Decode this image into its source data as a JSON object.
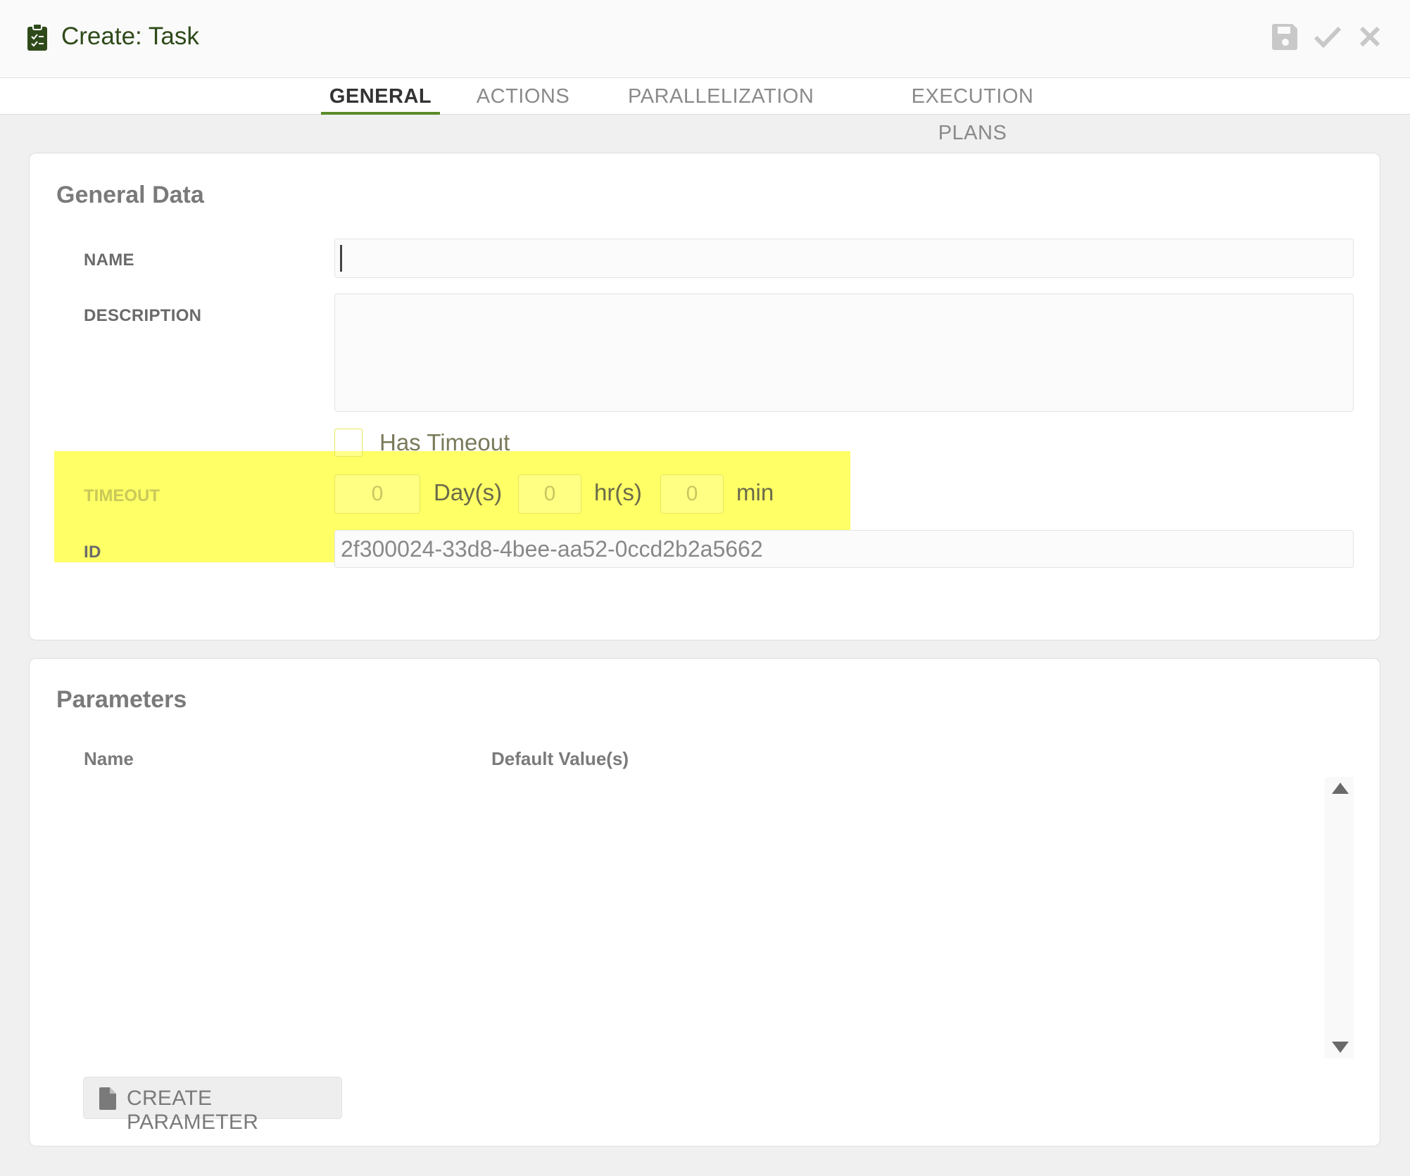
{
  "header": {
    "title": "Create: Task",
    "icons": {
      "title": "clipboard-check-icon",
      "save": "save-icon",
      "confirm": "checkmark-icon",
      "close": "close-icon"
    }
  },
  "tabs": [
    {
      "label": "GENERAL",
      "active": true
    },
    {
      "label": "ACTIONS",
      "active": false
    },
    {
      "label": "PARALLELIZATION",
      "active": false
    },
    {
      "label": "EXECUTION PLANS",
      "active": false
    }
  ],
  "general": {
    "heading": "General Data",
    "name": {
      "label": "NAME",
      "value": ""
    },
    "description": {
      "label": "DESCRIPTION",
      "value": ""
    },
    "has_timeout": {
      "label": "Has Timeout",
      "checked": false
    },
    "timeout": {
      "label": "TIMEOUT",
      "days": "0",
      "days_unit": "Day(s)",
      "hours": "0",
      "hours_unit": "hr(s)",
      "minutes": "0",
      "minutes_unit": "min"
    },
    "id": {
      "label": "ID",
      "value": "2f300024-33d8-4bee-aa52-0ccd2b2a5662"
    }
  },
  "parameters": {
    "heading": "Parameters",
    "columns": [
      "Name",
      "Default Value(s)"
    ],
    "rows": [],
    "create_button": "CREATE PARAMETER"
  },
  "colors": {
    "brand": "#2f4a1a",
    "tab_active_underline": "#5a8a2a",
    "highlight": "#ffff66"
  }
}
